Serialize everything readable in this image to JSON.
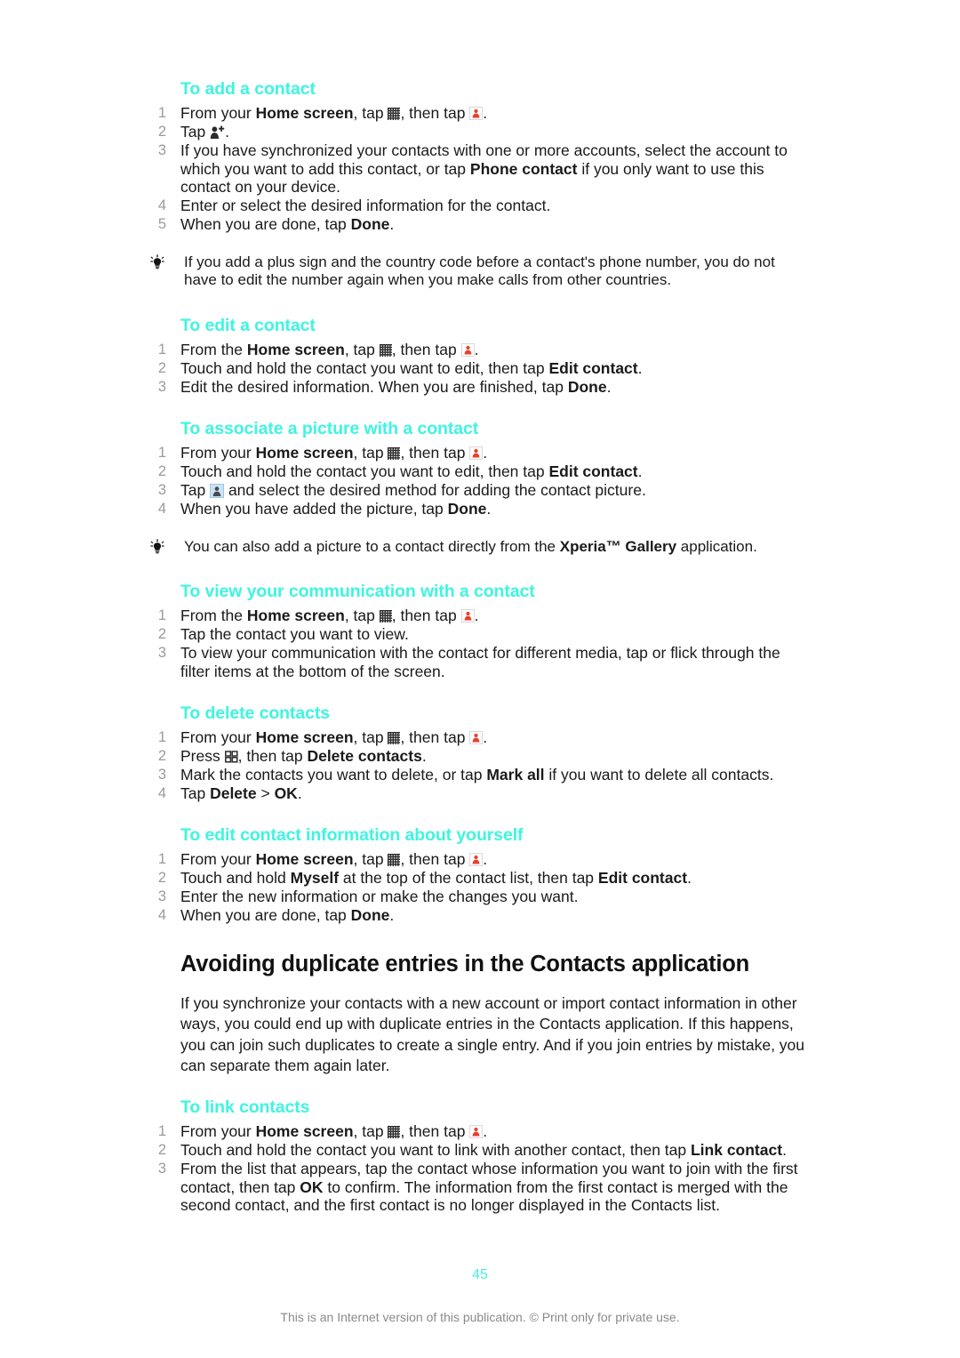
{
  "document": {
    "page_number": "45",
    "footer_note": "This is an Internet version of this publication. © Print only for private use."
  },
  "sections": {
    "add_contact": {
      "heading": "To add a contact",
      "steps": {
        "s1_a": "From your ",
        "s1_b": "Home screen",
        "s1_c": ", tap ",
        "s1_d": ", then tap ",
        "s1_e": ".",
        "s2_a": "Tap ",
        "s2_b": ".",
        "s3": "If you have synchronized your contacts with one or more accounts, select the account to which you want to add this contact, or tap ",
        "s3_bold": "Phone contact",
        "s3_end": " if you only want to use this contact on your device.",
        "s4": "Enter or select the desired information for the contact.",
        "s5_a": "When you are done, tap ",
        "s5_b": "Done",
        "s5_c": "."
      },
      "tip": "If you add a plus sign and the country code before a contact's phone number, you do not have to edit the number again when you make calls from other countries."
    },
    "edit_contact": {
      "heading": "To edit a contact",
      "steps": {
        "s1_a": "From the ",
        "s1_b": "Home screen",
        "s1_c": ", tap ",
        "s1_d": ", then tap ",
        "s1_e": ".",
        "s2_a": "Touch and hold the contact you want to edit, then tap ",
        "s2_b": "Edit contact",
        "s2_c": ".",
        "s3_a": "Edit the desired information. When you are finished, tap ",
        "s3_b": "Done",
        "s3_c": "."
      }
    },
    "associate_picture": {
      "heading": "To associate a picture with a contact",
      "steps": {
        "s1_a": "From your ",
        "s1_b": "Home screen",
        "s1_c": ", tap ",
        "s1_d": ", then tap ",
        "s1_e": ".",
        "s2_a": "Touch and hold the contact you want to edit, then tap ",
        "s2_b": "Edit contact",
        "s2_c": ".",
        "s3_a": "Tap ",
        "s3_b": " and select the desired method for adding the contact picture.",
        "s4_a": "When you have added the picture, tap ",
        "s4_b": "Done",
        "s4_c": "."
      },
      "tip_a": "You can also add a picture to a contact directly from the ",
      "tip_b": "Xperia™ Gallery",
      "tip_c": " application."
    },
    "view_communication": {
      "heading": "To view your communication with a contact",
      "steps": {
        "s1_a": "From the ",
        "s1_b": "Home screen",
        "s1_c": ", tap ",
        "s1_d": ", then tap ",
        "s1_e": ".",
        "s2": "Tap the contact you want to view.",
        "s3": "To view your communication with the contact for different media, tap or flick through the filter items at the bottom of the screen."
      }
    },
    "delete_contacts": {
      "heading": "To delete contacts",
      "steps": {
        "s1_a": "From your ",
        "s1_b": "Home screen",
        "s1_c": ", tap ",
        "s1_d": ", then tap ",
        "s1_e": ".",
        "s2_a": "Press ",
        "s2_b": ", then tap ",
        "s2_c": "Delete contacts",
        "s2_d": ".",
        "s3_a": "Mark the contacts you want to delete, or tap ",
        "s3_b": "Mark all",
        "s3_c": " if you want to delete all contacts.",
        "s4_a": "Tap ",
        "s4_b": "Delete",
        "s4_c": " > ",
        "s4_d": "OK",
        "s4_e": "."
      }
    },
    "edit_myself": {
      "heading": "To edit contact information about yourself",
      "steps": {
        "s1_a": "From your ",
        "s1_b": "Home screen",
        "s1_c": ", tap ",
        "s1_d": ", then tap ",
        "s1_e": ".",
        "s2_a": "Touch and hold ",
        "s2_b": "Myself",
        "s2_c": " at the top of the contact list, then tap ",
        "s2_d": "Edit contact",
        "s2_e": ".",
        "s3": "Enter the new information or make the changes you want.",
        "s4_a": "When you are done, tap ",
        "s4_b": "Done",
        "s4_c": "."
      }
    },
    "avoiding_duplicates": {
      "heading": "Avoiding duplicate entries in the Contacts application",
      "paragraph": "If you synchronize your contacts with a new account or import contact information in other ways, you could end up with duplicate entries in the Contacts application. If this happens, you can join such duplicates to create a single entry. And if you join entries by mistake, you can separate them again later."
    },
    "link_contacts": {
      "heading": "To link contacts",
      "steps": {
        "s1_a": "From your ",
        "s1_b": "Home screen",
        "s1_c": ", tap ",
        "s1_d": ", then tap ",
        "s1_e": ".",
        "s2_a": "Touch and hold the contact you want to link with another contact, then tap ",
        "s2_b": "Link contact",
        "s2_c": ".",
        "s3_a": "From the list that appears, tap the contact whose information you want to join with the first contact, then tap ",
        "s3_b": "OK",
        "s3_c": " to confirm. The information from the first contact is merged with the second contact, and the first contact is no longer displayed in the Contacts list."
      }
    }
  },
  "colors": {
    "heading_accent": "#3ef5e0",
    "step_number": "#9b9b9b",
    "body_text": "#1a1a1a",
    "footer_text": "#8a8a8a"
  },
  "icons": {
    "app_drawer": "app-drawer-icon",
    "contacts": "contacts-app-icon",
    "add_contact": "add-contact-icon",
    "picture": "contact-picture-icon",
    "menu_key": "menu-key-icon",
    "tip_bulb": "lightbulb-icon"
  }
}
